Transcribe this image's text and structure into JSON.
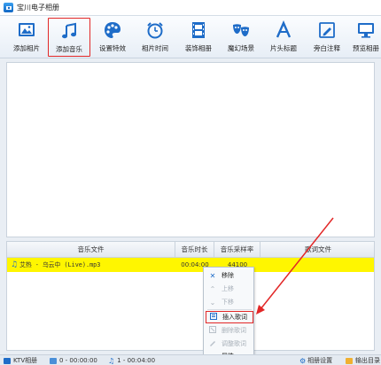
{
  "app": {
    "title": "宝川电子相册"
  },
  "toolbar": {
    "buttons": [
      {
        "label": "添加相片",
        "icon": "image-icon"
      },
      {
        "label": "添加音乐",
        "icon": "music-note-icon",
        "active": true
      },
      {
        "label": "设置特效",
        "icon": "palette-icon"
      },
      {
        "label": "相片时间",
        "icon": "alarm-clock-icon"
      },
      {
        "label": "装饰相册",
        "icon": "film-strip-icon"
      },
      {
        "label": "魔幻场景",
        "icon": "masks-icon"
      },
      {
        "label": "片头标题",
        "icon": "letter-a-icon"
      },
      {
        "label": "旁白注释",
        "icon": "pencil-note-icon"
      },
      {
        "label": "预览相册",
        "icon": "monitor-icon"
      }
    ]
  },
  "table": {
    "headers": [
      "音乐文件",
      "音乐时长",
      "音乐采样率",
      "歌词文件"
    ],
    "rows": [
      {
        "file": "艾热 - 乌云中 (Live).mp3",
        "duration": "00:04:00",
        "sample_rate": "44100",
        "lyrics": ""
      }
    ]
  },
  "context_menu": {
    "items": [
      {
        "label": "移除",
        "icon": "x-icon",
        "disabled": false
      },
      {
        "label": "上移",
        "icon": "up-chevron-icon",
        "disabled": true
      },
      {
        "label": "下移",
        "icon": "down-chevron-icon",
        "disabled": true
      },
      {
        "label": "插入歌词",
        "icon": "insert-lyrics-icon",
        "disabled": false,
        "highlight": true
      },
      {
        "label": "删除歌词",
        "icon": "delete-lyrics-icon",
        "disabled": true
      },
      {
        "label": "调整歌词",
        "icon": "adjust-lyrics-icon",
        "disabled": true
      },
      {
        "label": "属性",
        "icon": "dots-icon",
        "disabled": false
      }
    ]
  },
  "statusbar": {
    "mode": "KTV相册",
    "photo_count": "0 - 00:00:00",
    "music_count": "1 - 00:04:00",
    "album_settings": "相册设置",
    "output_dir": "输出目录"
  },
  "colors": {
    "highlight_row": "#fff600",
    "annotation_red": "#e22727",
    "accent_blue": "#1e6cc8"
  }
}
